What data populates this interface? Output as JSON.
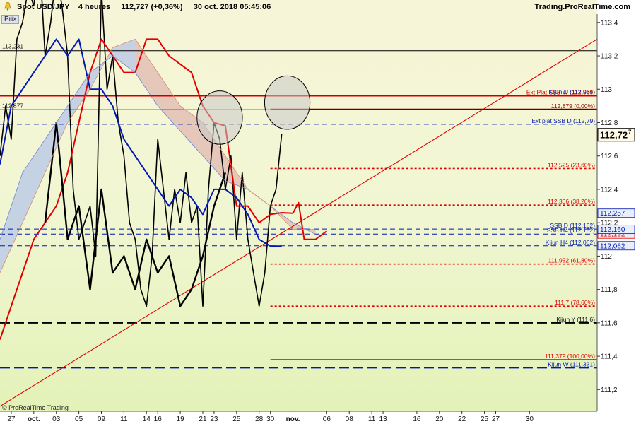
{
  "header": {
    "symbol": "Spot USD/JPY",
    "period": "4 heures",
    "last_and_change": "112,727 (+0,36%)",
    "datetime": "30 oct. 2018 05:45:06",
    "source": "Trading.ProRealTime.com"
  },
  "panel_label": "Prix",
  "footer": "© ProRealTime Trading",
  "colors": {
    "background_zone": "#eef7c8",
    "cloud_bull": "#b6c6e8",
    "cloud_bear": "#f2c3a8",
    "price": "#000000",
    "tenkan": "#e00000",
    "kijun": "#0018b4",
    "fib": "#e00000",
    "trendline": "#e00000"
  },
  "chart_data": {
    "type": "line",
    "y_axis": {
      "range": [
        111.07,
        113.45
      ],
      "tick_values": [
        111.2,
        111.4,
        111.6,
        111.8,
        112.0,
        112.2,
        112.4,
        112.6,
        112.8,
        113.0,
        113.2,
        113.4
      ],
      "tick_labels": [
        "111,2",
        "111,4",
        "111,6",
        "111,8",
        "112",
        "112,2",
        "112,4",
        "112,6",
        "112,8",
        "113",
        "113,2",
        "113,4"
      ],
      "highlight_labels": [
        {
          "text": "112,727",
          "value": 112.727,
          "style": "dark"
        },
        {
          "text": "112,257",
          "value": 112.257,
          "style": "blue"
        },
        {
          "text": "112,132",
          "value": 112.132,
          "style": "red"
        },
        {
          "text": "112,160",
          "value": 112.16,
          "style": "blue"
        },
        {
          "text": "112,062",
          "value": 112.062,
          "style": "blue"
        }
      ],
      "current_price_label": "112,72",
      "current_price_sup": "7",
      "current_price_value": 112.727
    },
    "x_axis": {
      "range": [
        0,
        53
      ],
      "ticks": [
        {
          "x": 1,
          "label": "27"
        },
        {
          "x": 3,
          "label": "oct.",
          "bold": true
        },
        {
          "x": 5,
          "label": "03"
        },
        {
          "x": 7,
          "label": "05"
        },
        {
          "x": 9,
          "label": "09"
        },
        {
          "x": 11,
          "label": "11"
        },
        {
          "x": 13,
          "label": "14"
        },
        {
          "x": 14,
          "label": "16"
        },
        {
          "x": 16,
          "label": "19"
        },
        {
          "x": 18,
          "label": "21"
        },
        {
          "x": 19,
          "label": "23"
        },
        {
          "x": 21,
          "label": "25"
        },
        {
          "x": 23,
          "label": "28"
        },
        {
          "x": 24,
          "label": "30"
        },
        {
          "x": 26,
          "label": "nov.",
          "bold": true
        },
        {
          "x": 29,
          "label": "06"
        },
        {
          "x": 31,
          "label": "08"
        },
        {
          "x": 33,
          "label": "11"
        },
        {
          "x": 34,
          "label": "13"
        },
        {
          "x": 37,
          "label": "16"
        },
        {
          "x": 39,
          "label": "20"
        },
        {
          "x": 41,
          "label": "22"
        },
        {
          "x": 43,
          "label": "25"
        },
        {
          "x": 44,
          "label": "27"
        },
        {
          "x": 47,
          "label": "30"
        }
      ]
    },
    "horizontal_lines": [
      {
        "value": 113.231,
        "style": "solid-thin",
        "color": "#000000",
        "label": "113,231",
        "label_side": "left"
      },
      {
        "value": 112.96,
        "style": "solid",
        "color": "#e00000",
        "label": "Ext Plat SSB W (112,960)",
        "label_side": "right"
      },
      {
        "value": 112.964,
        "style": "solid-thin",
        "color": "#0018b4",
        "label": "Kijun D (112,964)",
        "label_side": "right"
      },
      {
        "value": 112.879,
        "style": "solid-thick",
        "color": "#880000",
        "label": "112,879 (0,00%)",
        "label_side": "right"
      },
      {
        "value": 112.877,
        "style": "solid-thin",
        "color": "#000000",
        "label": "112,877",
        "label_side": "left"
      },
      {
        "value": 112.79,
        "style": "dashed",
        "color": "#0018b4",
        "label": "Ext plat SSB D (112,79)",
        "label_side": "right"
      },
      {
        "value": 112.525,
        "style": "dotted",
        "color": "#e00000",
        "label": "112,525 (23,60%)",
        "label_side": "right"
      },
      {
        "value": 112.306,
        "style": "dotted",
        "color": "#e00000",
        "label": "112,306 (38,20%)",
        "label_side": "right"
      },
      {
        "value": 112.162,
        "style": "dashed",
        "color": "#0018b4",
        "label": "SSB D (112,162)",
        "label_side": "right"
      },
      {
        "value": 112.132,
        "style": "dashed",
        "color": "#0018b4",
        "label": "SSB H4 (112,132)",
        "label_side": "right"
      },
      {
        "value": 112.062,
        "style": "dashed",
        "color": "#0018b4",
        "label": "Kijun H4 (112,062)",
        "label_side": "right"
      },
      {
        "value": 111.952,
        "style": "dotted",
        "color": "#e00000",
        "label": "111,952 (61,80%)",
        "label_side": "right"
      },
      {
        "value": 111.7,
        "style": "dotted",
        "color": "#e00000",
        "label": "111,7 (78,60%)",
        "label_side": "right"
      },
      {
        "value": 111.6,
        "style": "long-dash",
        "color": "#000000",
        "label": "Kijun Y (111,6)",
        "label_side": "right"
      },
      {
        "value": 111.379,
        "style": "solid",
        "color": "#e00000",
        "label": "111,379 (100,00%)",
        "label_side": "right"
      },
      {
        "value": 111.331,
        "style": "long-dash",
        "color": "#0018b4",
        "label": "Kijun W (111,331)",
        "label_side": "right"
      }
    ],
    "trendline": {
      "from": {
        "x": 0,
        "y": 111.1
      },
      "to": {
        "x": 53,
        "y": 113.3
      }
    },
    "circles": [
      {
        "x": 19.5,
        "y": 112.83,
        "r": 0.16
      },
      {
        "x": 25.5,
        "y": 112.92,
        "r": 0.16
      }
    ],
    "series": [
      {
        "name": "Prix",
        "style": "price",
        "points": [
          [
            0,
            112.6
          ],
          [
            0.5,
            112.9
          ],
          [
            1,
            112.7
          ],
          [
            1.5,
            113.3
          ],
          [
            2,
            113.4
          ],
          [
            2.5,
            113.6
          ],
          [
            3,
            113.5
          ],
          [
            3.5,
            113.8
          ],
          [
            4,
            113.2
          ],
          [
            4.5,
            113.4
          ],
          [
            5,
            113.7
          ],
          [
            5.5,
            113.5
          ],
          [
            6,
            113.2
          ],
          [
            6.5,
            112.4
          ],
          [
            7,
            112.1
          ],
          [
            7.5,
            112.2
          ],
          [
            8,
            112.3
          ],
          [
            8.5,
            112.0
          ],
          [
            9,
            113.6
          ],
          [
            9.5,
            113.0
          ],
          [
            10,
            113.2
          ],
          [
            10.5,
            112.8
          ],
          [
            11,
            112.6
          ],
          [
            11.5,
            112.2
          ],
          [
            12,
            112.1
          ],
          [
            12.5,
            111.8
          ],
          [
            13,
            111.7
          ],
          [
            13.5,
            112.0
          ],
          [
            14,
            112.7
          ],
          [
            14.5,
            112.4
          ],
          [
            15,
            112.1
          ],
          [
            15.5,
            112.4
          ],
          [
            16,
            112.2
          ],
          [
            16.5,
            112.5
          ],
          [
            17,
            112.2
          ],
          [
            17.5,
            112.3
          ],
          [
            18,
            111.7
          ],
          [
            18.5,
            112.4
          ],
          [
            19,
            112.8
          ],
          [
            19.5,
            112.7
          ],
          [
            20,
            112.4
          ],
          [
            20.5,
            112.6
          ],
          [
            21,
            112.1
          ],
          [
            21.5,
            112.5
          ],
          [
            22,
            112.1
          ],
          [
            22.5,
            111.9
          ],
          [
            23,
            111.7
          ],
          [
            23.5,
            111.9
          ],
          [
            24,
            112.3
          ],
          [
            24.5,
            112.4
          ],
          [
            25,
            112.73
          ]
        ]
      },
      {
        "name": "Tenkan",
        "style": "tenkan",
        "points": [
          [
            0,
            111.5
          ],
          [
            1,
            111.7
          ],
          [
            2,
            111.9
          ],
          [
            3,
            112.1
          ],
          [
            4,
            112.2
          ],
          [
            5,
            112.3
          ],
          [
            6,
            112.5
          ],
          [
            7,
            112.8
          ],
          [
            8,
            113.1
          ],
          [
            9,
            113.3
          ],
          [
            10,
            113.2
          ],
          [
            11,
            113.1
          ],
          [
            12,
            113.1
          ],
          [
            13,
            113.3
          ],
          [
            14,
            113.3
          ],
          [
            15,
            113.2
          ],
          [
            16,
            113.15
          ],
          [
            17,
            113.1
          ],
          [
            18,
            112.9
          ],
          [
            19,
            112.8
          ],
          [
            20,
            112.78
          ],
          [
            21,
            112.3
          ],
          [
            22,
            112.3
          ],
          [
            23,
            112.2
          ],
          [
            24,
            112.25
          ],
          [
            25,
            112.26
          ],
          [
            26,
            112.257
          ],
          [
            26.5,
            112.32
          ],
          [
            27,
            112.1
          ],
          [
            28,
            112.1
          ],
          [
            29,
            112.15
          ]
        ]
      },
      {
        "name": "Kijun",
        "style": "kijun",
        "points": [
          [
            0,
            112.55
          ],
          [
            1,
            112.9
          ],
          [
            2,
            113.0
          ],
          [
            3,
            113.1
          ],
          [
            4,
            113.2
          ],
          [
            5,
            113.3
          ],
          [
            6,
            113.2
          ],
          [
            7,
            113.3
          ],
          [
            8,
            113.0
          ],
          [
            9,
            113.0
          ],
          [
            10,
            112.9
          ],
          [
            11,
            112.7
          ],
          [
            12,
            112.6
          ],
          [
            13,
            112.5
          ],
          [
            14,
            112.4
          ],
          [
            15,
            112.3
          ],
          [
            16,
            112.4
          ],
          [
            17,
            112.35
          ],
          [
            18,
            112.25
          ],
          [
            19,
            112.4
          ],
          [
            20,
            112.4
          ],
          [
            21,
            112.35
          ],
          [
            22,
            112.25
          ],
          [
            23,
            112.1
          ],
          [
            24,
            112.06
          ],
          [
            25,
            112.06
          ]
        ]
      },
      {
        "name": "Chikou",
        "style": "chikou",
        "points": [
          [
            4,
            112.2
          ],
          [
            5,
            112.8
          ],
          [
            6,
            112.1
          ],
          [
            7,
            112.3
          ],
          [
            8,
            111.8
          ],
          [
            9,
            112.4
          ],
          [
            10,
            111.9
          ],
          [
            11,
            112.0
          ],
          [
            12,
            111.8
          ],
          [
            13,
            112.1
          ],
          [
            14,
            111.9
          ],
          [
            15,
            112.0
          ],
          [
            16,
            111.7
          ],
          [
            17,
            111.8
          ],
          [
            18,
            112.0
          ],
          [
            19,
            112.3
          ],
          [
            20,
            112.5
          ]
        ]
      },
      {
        "name": "SSA",
        "style": "ssa",
        "points": [
          [
            0,
            112.1
          ],
          [
            2,
            112.5
          ],
          [
            4,
            112.7
          ],
          [
            6,
            112.9
          ],
          [
            8,
            113.1
          ],
          [
            10,
            113.2
          ],
          [
            12,
            113.1
          ],
          [
            14,
            112.9
          ],
          [
            16,
            112.75
          ],
          [
            18,
            112.6
          ],
          [
            20,
            112.45
          ],
          [
            22,
            112.4
          ],
          [
            24,
            112.3
          ],
          [
            26,
            112.2
          ],
          [
            28,
            112.13
          ]
        ]
      },
      {
        "name": "SSB",
        "style": "ssb",
        "points": [
          [
            0,
            111.9
          ],
          [
            2,
            112.2
          ],
          [
            4,
            112.5
          ],
          [
            6,
            112.8
          ],
          [
            8,
            113.0
          ],
          [
            10,
            113.25
          ],
          [
            12,
            113.3
          ],
          [
            14,
            113.1
          ],
          [
            16,
            112.9
          ],
          [
            18,
            112.8
          ],
          [
            20,
            112.6
          ],
          [
            22,
            112.4
          ],
          [
            24,
            112.3
          ],
          [
            26,
            112.16
          ],
          [
            28,
            112.16
          ]
        ]
      }
    ]
  }
}
